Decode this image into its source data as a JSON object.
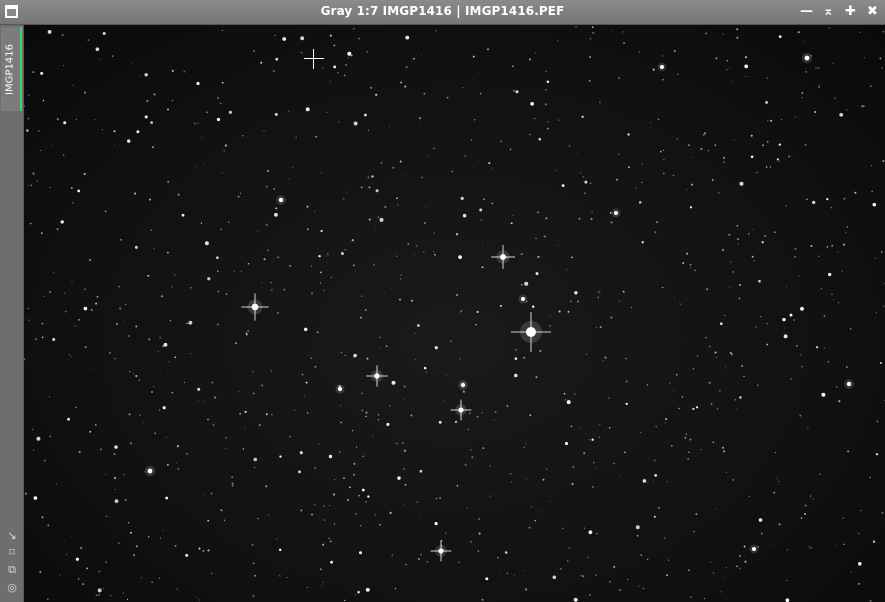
{
  "window": {
    "title": "Gray 1:7 IMGP1416 | IMGP1416.PEF",
    "icon": "window-menu-icon",
    "buttons": [
      {
        "name": "minimize-button",
        "glyph": "—"
      },
      {
        "name": "shade-button",
        "glyph": "⌅"
      },
      {
        "name": "maximize-button",
        "glyph": "✚"
      },
      {
        "name": "close-button",
        "glyph": "✖"
      }
    ]
  },
  "sidebar": {
    "tab_label": "IMGP1416",
    "tools": [
      {
        "name": "resize-icon",
        "glyph": "↘"
      },
      {
        "name": "fit-icon",
        "glyph": "⌑"
      },
      {
        "name": "clone-icon",
        "glyph": "⧉"
      },
      {
        "name": "target-icon",
        "glyph": "◎"
      }
    ]
  },
  "image": {
    "description_color": "#000000",
    "accent_tab": "#3fcf6f"
  }
}
